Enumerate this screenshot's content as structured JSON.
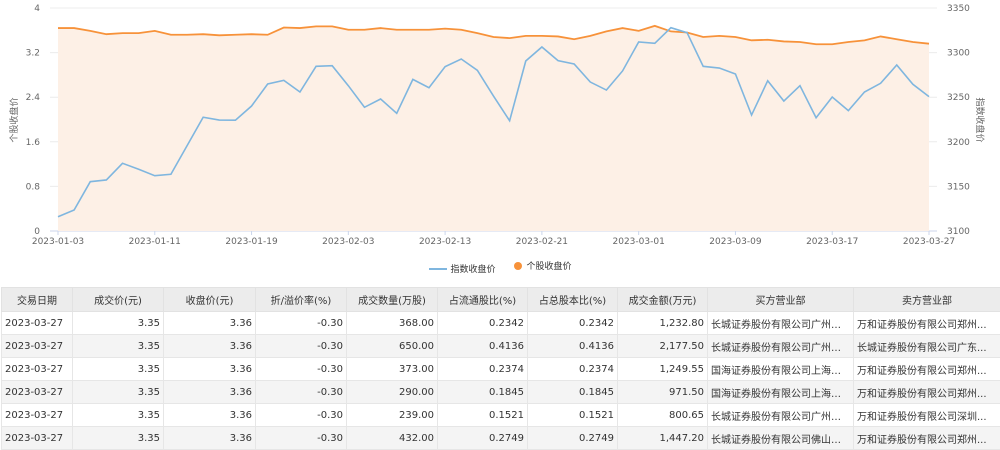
{
  "chart_data": {
    "type": "line",
    "left_ylabel": "个股收盘价",
    "right_ylabel": "指数收盘价",
    "left_ylim": [
      0,
      4
    ],
    "left_ticks": [
      "0",
      "0.8",
      "1.6",
      "2.4",
      "3.2",
      "4"
    ],
    "right_ylim": [
      3100,
      3350
    ],
    "right_ticks": [
      "3100",
      "3150",
      "3200",
      "3250",
      "3300",
      "3350"
    ],
    "x_tick_labels": [
      "2023-01-03",
      "2023-01-11",
      "2023-01-19",
      "2023-02-03",
      "2023-02-13",
      "2023-02-21",
      "2023-03-01",
      "2023-03-09",
      "2023-03-17",
      "2023-03-27"
    ],
    "x": [
      "2023-01-03",
      "2023-01-04",
      "2023-01-05",
      "2023-01-06",
      "2023-01-09",
      "2023-01-10",
      "2023-01-11",
      "2023-01-12",
      "2023-01-13",
      "2023-01-16",
      "2023-01-17",
      "2023-01-18",
      "2023-01-19",
      "2023-01-20",
      "2023-01-30",
      "2023-01-31",
      "2023-02-01",
      "2023-02-02",
      "2023-02-03",
      "2023-02-06",
      "2023-02-07",
      "2023-02-08",
      "2023-02-09",
      "2023-02-10",
      "2023-02-13",
      "2023-02-14",
      "2023-02-15",
      "2023-02-16",
      "2023-02-17",
      "2023-02-20",
      "2023-02-21",
      "2023-02-22",
      "2023-02-23",
      "2023-02-24",
      "2023-02-27",
      "2023-02-28",
      "2023-03-01",
      "2023-03-02",
      "2023-03-03",
      "2023-03-06",
      "2023-03-07",
      "2023-03-08",
      "2023-03-09",
      "2023-03-10",
      "2023-03-13",
      "2023-03-14",
      "2023-03-15",
      "2023-03-16",
      "2023-03-17",
      "2023-03-20",
      "2023-03-21",
      "2023-03-22",
      "2023-03-23",
      "2023-03-24",
      "2023-03-27"
    ],
    "legend_position": "bottom",
    "series": [
      {
        "name": "指数收盘价",
        "axis": "right",
        "color": "#7fb6df",
        "values": [
          3116,
          3123.5,
          3155.3,
          3157.2,
          3175.9,
          3169.2,
          3162,
          3163.6,
          3195.6,
          3227.5,
          3224.4,
          3224.2,
          3240.1,
          3264.8,
          3268.9,
          3255.8,
          3284.6,
          3285.3,
          3262.9,
          3238.7,
          3248,
          3231.9,
          3270,
          3260.6,
          3284.2,
          3292.8,
          3280.1,
          3251.3,
          3223.6,
          3290.6,
          3306.3,
          3291,
          3287.2,
          3267,
          3258,
          3279.4,
          3311.9,
          3310.4,
          3327.9,
          3322.3,
          3284.6,
          3282.7,
          3276,
          3230,
          3268.5,
          3245.7,
          3262.9,
          3227,
          3250.2,
          3234.9,
          3255.8,
          3265.6,
          3286.1,
          3264.5,
          3250.6
        ]
      },
      {
        "name": "个股收盘价",
        "axis": "left",
        "color": "#f7923a",
        "values": [
          3.64,
          3.64,
          3.59,
          3.53,
          3.55,
          3.55,
          3.59,
          3.52,
          3.52,
          3.53,
          3.51,
          3.52,
          3.53,
          3.52,
          3.65,
          3.64,
          3.67,
          3.67,
          3.61,
          3.61,
          3.64,
          3.61,
          3.61,
          3.61,
          3.63,
          3.61,
          3.55,
          3.48,
          3.46,
          3.5,
          3.5,
          3.49,
          3.44,
          3.5,
          3.58,
          3.64,
          3.59,
          3.68,
          3.58,
          3.56,
          3.48,
          3.5,
          3.48,
          3.42,
          3.43,
          3.4,
          3.39,
          3.35,
          3.35,
          3.39,
          3.42,
          3.49,
          3.44,
          3.39,
          3.36
        ]
      }
    ]
  },
  "table": {
    "headers": [
      "交易日期",
      "成交价(元)",
      "收盘价(元)",
      "折/溢价率(%)",
      "成交数量(万股)",
      "占流通股比(%)",
      "占总股本比(%)",
      "成交金额(万元)",
      "买方营业部",
      "卖方营业部"
    ],
    "rows": [
      [
        "2023-03-27",
        "3.35",
        "3.36",
        "-0.30",
        "368.00",
        "0.2342",
        "0.2342",
        "1,232.80",
        "长城证券股份有限公司广州天...",
        "万和证券股份有限公司郑州..."
      ],
      [
        "2023-03-27",
        "3.35",
        "3.36",
        "-0.30",
        "650.00",
        "0.4136",
        "0.4136",
        "2,177.50",
        "长城证券股份有限公司广州天...",
        "长城证券股份有限公司广东..."
      ],
      [
        "2023-03-27",
        "3.35",
        "3.36",
        "-0.30",
        "373.00",
        "0.2374",
        "0.2374",
        "1,249.55",
        "国海证券股份有限公司上海世...",
        "万和证券股份有限公司郑州..."
      ],
      [
        "2023-03-27",
        "3.35",
        "3.36",
        "-0.30",
        "290.00",
        "0.1845",
        "0.1845",
        "971.50",
        "国海证券股份有限公司上海世...",
        "万和证券股份有限公司郑州..."
      ],
      [
        "2023-03-27",
        "3.35",
        "3.36",
        "-0.30",
        "239.00",
        "0.1521",
        "0.1521",
        "800.65",
        "长城证券股份有限公司广州天...",
        "万和证券股份有限公司深圳..."
      ],
      [
        "2023-03-27",
        "3.35",
        "3.36",
        "-0.30",
        "432.00",
        "0.2749",
        "0.2749",
        "1,447.20",
        "长城证券股份有限公司佛山顺...",
        "万和证券股份有限公司郑州..."
      ]
    ]
  }
}
